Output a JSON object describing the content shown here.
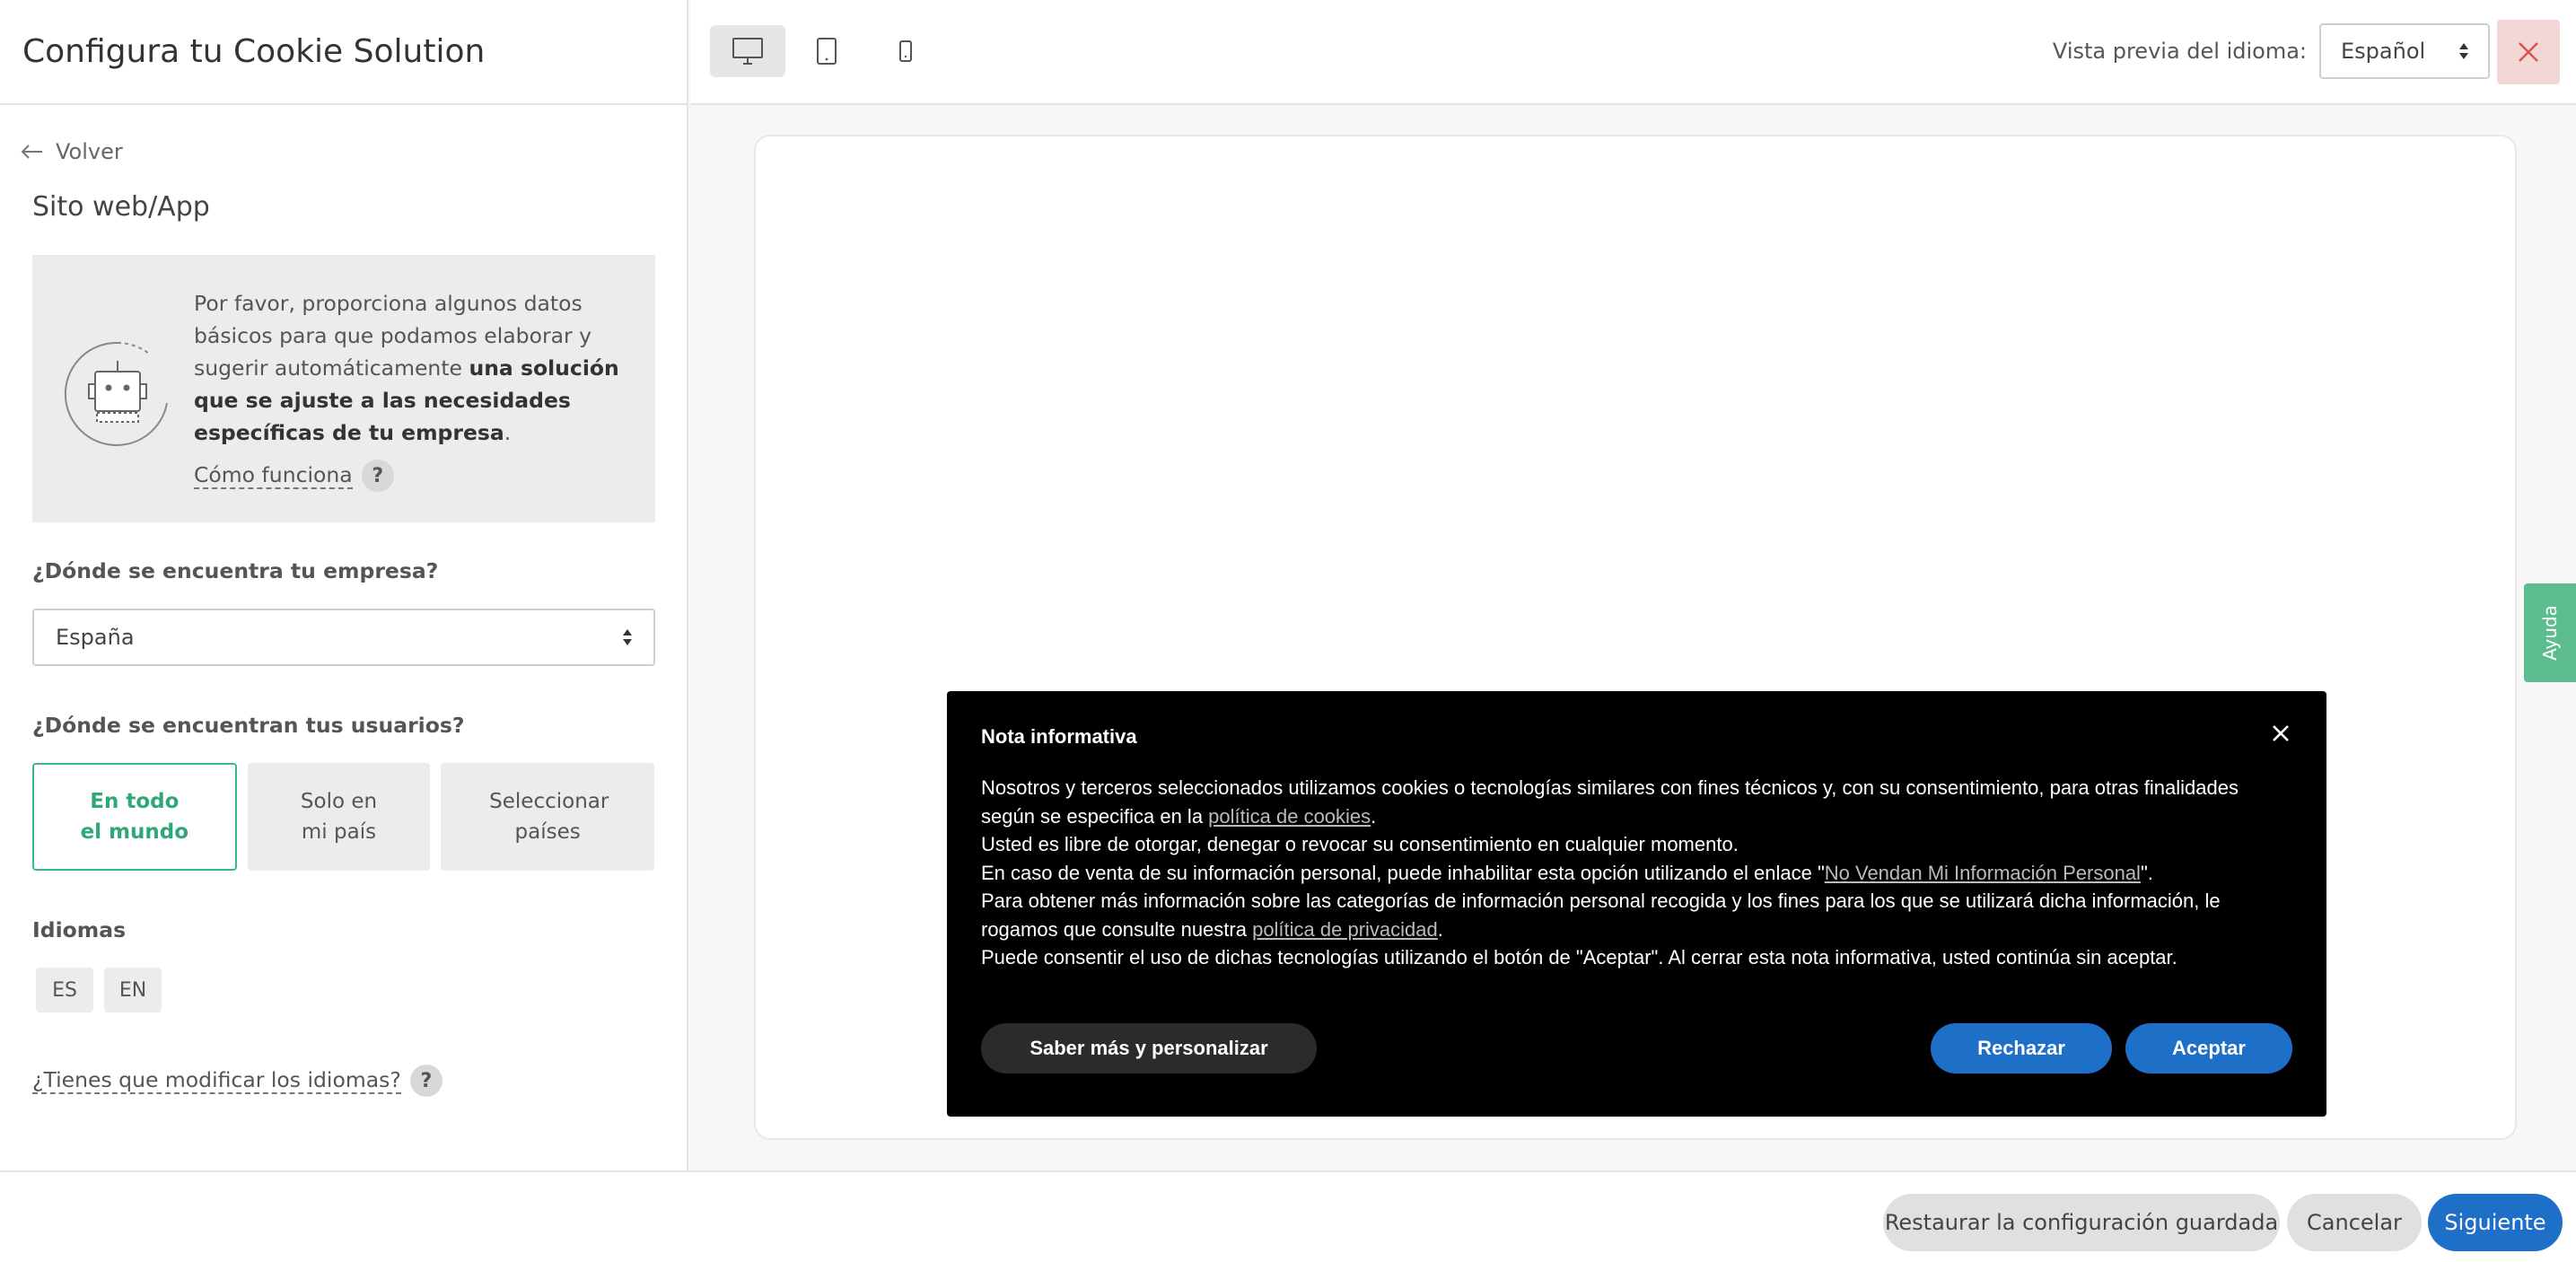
{
  "left_panel": {
    "title": "Configura tu Cookie Solution",
    "back_label": "Volver",
    "section_title": "Sito web/App",
    "info": {
      "text_1": "Por favor, proporciona algunos datos básicos para que podamos elaborar y sugerir automáticamente ",
      "text_bold": "una solución que se ajuste a las necesidades específicas de tu empresa",
      "text_2": ".",
      "link": "Cómo funciona",
      "help_badge": "?"
    },
    "company_question": "¿Dónde se encuentra tu empresa?",
    "company_value": "España",
    "users_question": "¿Dónde se encuentran tus usuarios?",
    "user_options": [
      "En todo el mundo",
      "Solo en mi país",
      "Seleccionar países"
    ],
    "languages_label": "Idiomas",
    "languages": [
      "ES",
      "EN"
    ],
    "modify_languages": "¿Tienes que modificar los idiomas?",
    "modify_help": "?"
  },
  "topbar": {
    "devices": [
      "desktop-icon",
      "tablet-icon",
      "mobile-icon"
    ],
    "language_preview_label": "Vista previa del idioma:",
    "language_value": "Español"
  },
  "banner": {
    "title": "Nota informativa",
    "line1a": "Nosotros y terceros seleccionados utilizamos cookies o tecnologías similares con fines técnicos y, con su consentimiento, para otras finalidades según se especifica en la ",
    "link_cookies": "política de cookies",
    "line1b": ".",
    "line2": "Usted es libre de otorgar, denegar o revocar su consentimiento en cualquier momento.",
    "line3a": "En caso de venta de su información personal, puede inhabilitar esta opción utilizando el enlace \"",
    "link_dns": "No Vendan Mi Información Personal",
    "line3b": "\".",
    "line4a": "Para obtener más información sobre las categorías de información personal recogida y los fines para los que se utilizará dicha información, le rogamos que consulte nuestra ",
    "link_privacy": "política de privacidad",
    "line4b": ".",
    "line5": "Puede consentir el uso de dichas tecnologías utilizando el botón de \"Aceptar\". Al cerrar esta nota informativa, usted continúa sin aceptar.",
    "btn_more": "Saber más y personalizar",
    "btn_reject": "Rechazar",
    "btn_accept": "Aceptar"
  },
  "help_tab": "Ayuda",
  "footer": {
    "restore": "Restaurar la configuración guardada",
    "cancel": "Cancelar",
    "next": "Siguiente"
  },
  "colors": {
    "accent_blue": "#1e6fc8",
    "accent_green": "#3aba8c",
    "close_bg": "#f3d6d6",
    "close_x": "#d9534f"
  }
}
